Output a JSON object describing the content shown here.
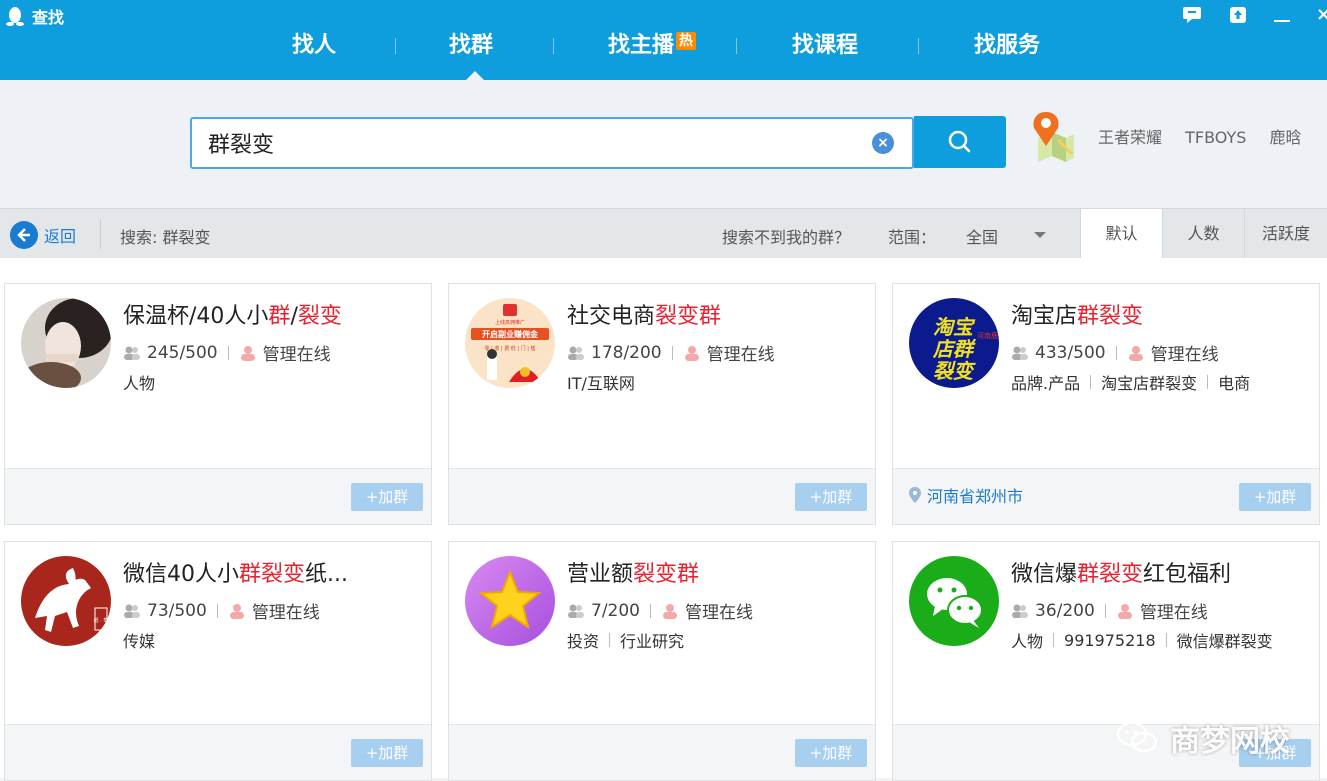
{
  "window": {
    "title": "查找",
    "controls": [
      "feedback-icon",
      "upload-icon",
      "minimize-icon",
      "close-icon"
    ]
  },
  "nav": {
    "items": [
      {
        "label": "找人"
      },
      {
        "label": "找群"
      },
      {
        "label": "找主播",
        "badge": "热"
      },
      {
        "label": "找课程"
      },
      {
        "label": "找服务"
      }
    ],
    "active_index": 1
  },
  "search": {
    "value": "群裂变",
    "hot_words": [
      "王者荣耀",
      "TFBOYS",
      "鹿晗"
    ]
  },
  "filter": {
    "back_label": "返回",
    "search_label": "搜索: 群裂变",
    "not_found": "搜索不到我的群？",
    "range_label": "范围：",
    "range_value": "全国",
    "sort_tabs": [
      "默认",
      "人数",
      "活跃度"
    ],
    "sort_active": 0
  },
  "groups": [
    {
      "title_parts": [
        {
          "t": "保温杯/40人小",
          "h": false
        },
        {
          "t": "群",
          "h": true
        },
        {
          "t": "/",
          "h": false
        },
        {
          "t": "裂变",
          "h": true
        }
      ],
      "members": "245/500",
      "admin": "管理在线",
      "tags": [
        "人物"
      ],
      "join": "+加群",
      "location": ""
    },
    {
      "title_parts": [
        {
          "t": "社交电商",
          "h": false
        },
        {
          "t": "裂变群",
          "h": true
        }
      ],
      "members": "178/200",
      "admin": "管理在线",
      "tags": [
        "IT/互联网"
      ],
      "join": "+加群",
      "location": ""
    },
    {
      "title_parts": [
        {
          "t": "淘宝店",
          "h": false
        },
        {
          "t": "群裂变",
          "h": true
        }
      ],
      "members": "433/500",
      "admin": "管理在线",
      "tags": [
        "品牌.产品",
        "淘宝店群裂变",
        "电商"
      ],
      "join": "+加群",
      "location": "河南省郑州市"
    },
    {
      "title_parts": [
        {
          "t": "微信40人小",
          "h": false
        },
        {
          "t": "群裂变",
          "h": true
        },
        {
          "t": "纸...",
          "h": false
        }
      ],
      "members": "73/500",
      "admin": "管理在线",
      "tags": [
        "传媒"
      ],
      "join": "+加群",
      "location": ""
    },
    {
      "title_parts": [
        {
          "t": "营业额",
          "h": false
        },
        {
          "t": "裂变群",
          "h": true
        }
      ],
      "members": "7/200",
      "admin": "管理在线",
      "tags": [
        "投资",
        "行业研究"
      ],
      "join": "+加群",
      "location": ""
    },
    {
      "title_parts": [
        {
          "t": "微信爆",
          "h": false
        },
        {
          "t": "群裂变",
          "h": true
        },
        {
          "t": "红包福利",
          "h": false
        }
      ],
      "members": "36/200",
      "admin": "管理在线",
      "tags": [
        "人物",
        "991975218",
        "微信爆群裂变"
      ],
      "join": "+加群",
      "location": ""
    }
  ],
  "avatar_text": {
    "taobao": [
      "淘宝",
      "店群",
      "裂变"
    ],
    "taobao_side": "河南鹿邑",
    "ecommerce_banner": "开启副业赚佣金",
    "ecommerce_top": "上线高佣推广",
    "ecommerce_sub": "零 | 收 | 费  低 | 门 | 槛",
    "weixin_stamp": "纸 · 笔"
  },
  "watermark": "商梦网校",
  "colors": {
    "topbar": "#0e9ede",
    "highlight": "#e8222f",
    "join": "#a6cff0",
    "link": "#1a7cd0"
  }
}
